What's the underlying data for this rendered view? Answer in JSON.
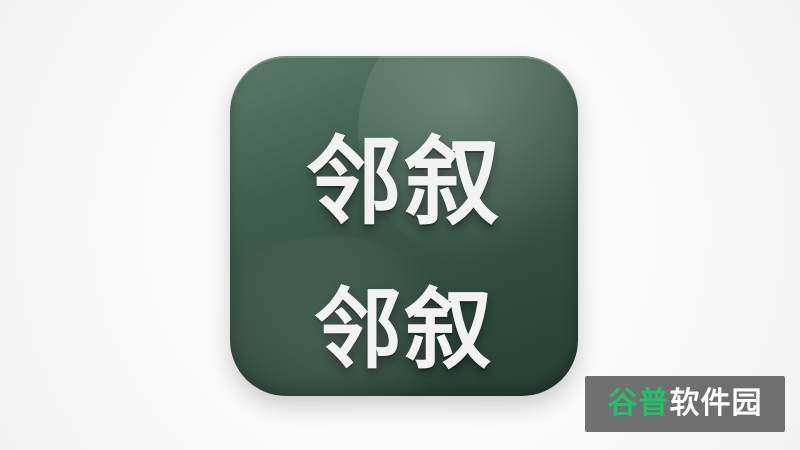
{
  "icon": {
    "line1": "邻叙",
    "line2": "邻叙",
    "colors": {
      "tile": "#3f5d4f",
      "text": "#f2f2f2"
    }
  },
  "watermark": {
    "part1": "谷普",
    "part2": "软件园",
    "colors": {
      "background": "#000000",
      "accent": "#23c06b",
      "text": "#ffffff"
    }
  }
}
